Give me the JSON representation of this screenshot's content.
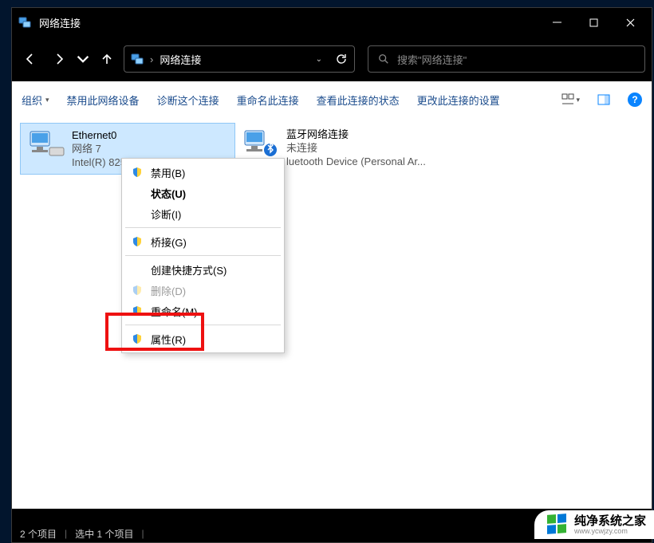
{
  "window": {
    "title": "网络连接",
    "min": "—",
    "max": "☐",
    "close": "✕"
  },
  "address": {
    "sep": "›",
    "label": "网络连接"
  },
  "search": {
    "placeholder": "搜索\"网络连接\""
  },
  "cmdbar": {
    "organize": "组织",
    "disable": "禁用此网络设备",
    "diagnose": "诊断这个连接",
    "rename": "重命名此连接",
    "viewstatus": "查看此连接的状态",
    "changeset": "更改此连接的设置"
  },
  "items": {
    "eth": {
      "name": "Ethernet0",
      "net": "网络 7",
      "adapter": "Intel(R) 825"
    },
    "bt": {
      "name": "蓝牙网络连接",
      "status": "未连接",
      "adapter": "luetooth Device (Personal Ar..."
    }
  },
  "menu": {
    "disable": "禁用(B)",
    "status": "状态(U)",
    "diagnose": "诊断(I)",
    "bridge": "桥接(G)",
    "shortcut": "创建快捷方式(S)",
    "delete": "删除(D)",
    "rename": "重命名(M)",
    "props": "属性(R)"
  },
  "statusbar": {
    "count": "2 个项目",
    "sel": "选中 1 个项目"
  },
  "watermark": {
    "name": "纯净系统之家",
    "url": "www.ycwjzy.com"
  }
}
